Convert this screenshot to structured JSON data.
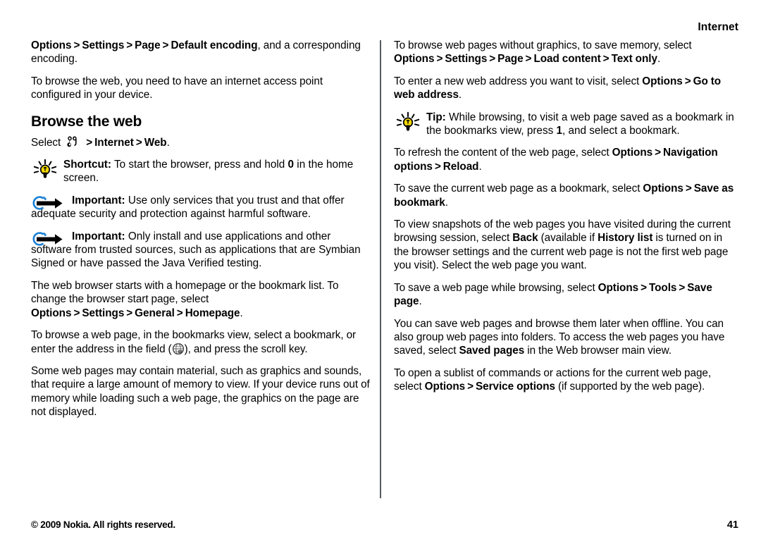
{
  "header": {
    "running_title": "Internet"
  },
  "footer": {
    "copyright": "© 2009 Nokia. All rights reserved.",
    "page_number": "41"
  },
  "left_column": {
    "p1": {
      "b1": "Options",
      "gt1": ">",
      "b2": "Settings",
      "gt2": ">",
      "b3": "Page",
      "gt3": ">",
      "b4": "Default encoding",
      "tail": ", and a corresponding encoding."
    },
    "p2": "To browse the web, you need to have an internet access point configured in your device.",
    "section_title": "Browse the web",
    "p3": {
      "lead": "Select",
      "icon": "nokia-menu-key-icon",
      "gt1": ">",
      "b1": "Internet",
      "gt2": ">",
      "b2": "Web",
      "tail": "."
    },
    "tip1": {
      "icon": "lightbulb-icon",
      "label": "Shortcut:",
      "text_before": " To start the browser, press and hold ",
      "key": "0",
      "text_after": " in the home screen."
    },
    "important1": {
      "icon": "important-arrow-icon",
      "label": "Important:",
      "text": " Use only services that you trust and that offer adequate security and protection against harmful software."
    },
    "important2": {
      "icon": "important-arrow-icon",
      "label": "Important:",
      "text": " Only install and use applications and other software from trusted sources, such as applications that are Symbian Signed or have passed the Java Verified testing."
    },
    "p4": {
      "lead": "The web browser starts with a homepage or the bookmark list. To change the browser start page, select ",
      "b1": "Options",
      "gt1": ">",
      "b2": "Settings",
      "gt2": ">",
      "b3": "General",
      "gt3": ">",
      "b4": "Homepage",
      "tail": "."
    },
    "p5": {
      "lead": "To browse a web page, in the bookmarks view, select a bookmark, or enter the address in the field (",
      "icon": "globe-icon",
      "tail": "), and press the scroll key."
    },
    "p6": "Some web pages may contain material, such as graphics and sounds, that require a large amount of memory to view. If your device runs out of memory while loading such a web page, the graphics on the page are not displayed."
  },
  "right_column": {
    "p1": {
      "lead": "To browse web pages without graphics, to save memory, select ",
      "b1": "Options",
      "gt1": ">",
      "b2": "Settings",
      "gt2": ">",
      "b3": "Page",
      "gt3": ">",
      "b4": "Load content",
      "gt4": ">",
      "b5": "Text only",
      "tail": "."
    },
    "p2": {
      "lead": "To enter a new web address you want to visit, select ",
      "b1": "Options",
      "gt1": ">",
      "b2": "Go to web address",
      "tail": "."
    },
    "tip1": {
      "icon": "lightbulb-icon",
      "label": "Tip:",
      "text_before": " While browsing, to visit a web page saved as a bookmark in the bookmarks view, press ",
      "key": "1",
      "text_after": ", and select a bookmark."
    },
    "p3": {
      "lead": "To refresh the content of the web page, select ",
      "b1": "Options",
      "gt1": ">",
      "b2": "Navigation options",
      "gt2": ">",
      "b3": "Reload",
      "tail": "."
    },
    "p4": {
      "lead": "To save the current web page as a bookmark, select ",
      "b1": "Options",
      "gt1": ">",
      "b2": "Save as bookmark",
      "tail": "."
    },
    "p5": {
      "lead": "To view snapshots of the web pages you have visited during the current browsing session, select ",
      "b1": "Back",
      "mid1": " (available if ",
      "b2": "History list",
      "tail": " is turned on in the browser settings and the current web page is not the first web page you visit). Select the web page you want."
    },
    "p6": {
      "lead": "To save a web page while browsing, select ",
      "b1": "Options",
      "gt1": ">",
      "b2": "Tools",
      "gt2": ">",
      "b3": "Save page",
      "tail": "."
    },
    "p7": {
      "lead": "You can save web pages and browse them later when offline. You can also group web pages into folders. To access the web pages you have saved, select ",
      "b1": "Saved pages",
      "tail": " in the Web browser main view."
    },
    "p8": {
      "lead": "To open a sublist of commands or actions for the current web page, select ",
      "b1": "Options",
      "gt1": ">",
      "b2": "Service options",
      "tail": " (if supported by the web page)."
    }
  },
  "colors": {
    "text": "#000000",
    "divider": "#555b5e",
    "important_circle": "#1a7fd4",
    "bulb_yellow": "#f5d800",
    "background": "#ffffff"
  }
}
